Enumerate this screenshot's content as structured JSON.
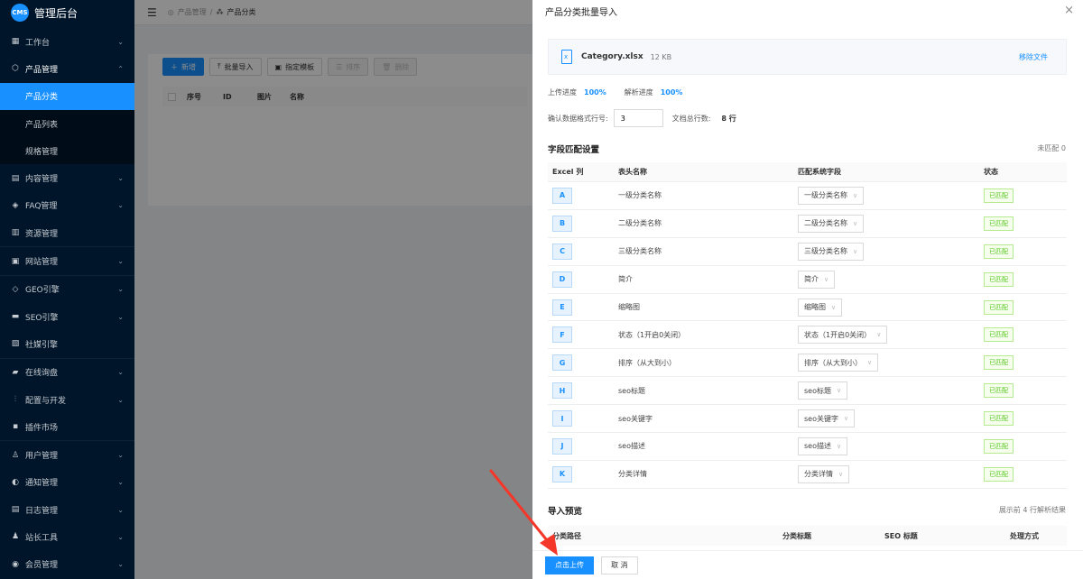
{
  "app": {
    "logo_badge": "CMS",
    "title": "管理后台"
  },
  "sidebar": {
    "items": [
      {
        "label": "工作台",
        "icon": "dashboard-icon",
        "chevron": "⌄"
      },
      {
        "label": "产品管理",
        "icon": "cube-icon",
        "chevron": "⌃"
      },
      {
        "label": "内容管理",
        "icon": "document-icon",
        "chevron": "⌄"
      },
      {
        "label": "FAQ管理",
        "icon": "tag-icon",
        "chevron": "⌄"
      },
      {
        "label": "资源管理",
        "icon": "folder-icon",
        "chevron": ""
      },
      {
        "label": "网站管理",
        "icon": "globe-icon",
        "chevron": "⌄"
      },
      {
        "label": "GEO引擎",
        "icon": "diamond-icon",
        "chevron": "⌄"
      },
      {
        "label": "SEO引擎",
        "icon": "monitor-icon",
        "chevron": "⌄"
      },
      {
        "label": "社媒引擎",
        "icon": "share-icon",
        "chevron": ""
      },
      {
        "label": "在线询盘",
        "icon": "chat-icon",
        "chevron": "⌄"
      },
      {
        "label": "配置与开发",
        "icon": "sliders-icon",
        "chevron": "⌄"
      },
      {
        "label": "插件市场",
        "icon": "plugin-icon",
        "chevron": ""
      },
      {
        "label": "用户管理",
        "icon": "user-icon",
        "chevron": "⌄"
      },
      {
        "label": "通知管理",
        "icon": "bell-icon",
        "chevron": "⌄"
      },
      {
        "label": "日志管理",
        "icon": "log-icon",
        "chevron": "⌄"
      },
      {
        "label": "站长工具",
        "icon": "tool-icon",
        "chevron": "⌄"
      },
      {
        "label": "会员管理",
        "icon": "member-icon",
        "chevron": "⌄"
      }
    ],
    "sub_items": [
      "产品分类",
      "产品列表",
      "规格管理"
    ]
  },
  "topbar": {
    "crumb1": "产品管理",
    "sep": "/",
    "crumb2": "产品分类"
  },
  "toolbar": {
    "add": "新增",
    "batch_import": "批量导入",
    "template": "指定模板",
    "sort": "排序",
    "delete": "删除"
  },
  "list_table": {
    "headers": [
      "序号",
      "ID",
      "图片",
      "名称"
    ]
  },
  "drawer": {
    "title": "产品分类批量导入",
    "close": "×",
    "file_name": "Category.xlsx",
    "file_size": "12 KB",
    "remove": "移除文件",
    "upload_progress_label": "上传进度",
    "upload_progress": "100%",
    "parse_progress_label": "解析进度",
    "parse_progress": "100%",
    "format_row_label": "确认数据格式行号:",
    "format_row_value": "3",
    "total_rows_label": "文档总行数:",
    "total_rows_value": "8 行",
    "mapping_title": "字段匹配设置",
    "unmatched": "未匹配 0",
    "mapping_headers": [
      "Excel 列",
      "表头名称",
      "匹配系统字段",
      "状态"
    ],
    "rows": [
      {
        "col": "A",
        "header": "一级分类名称",
        "field": "一级分类名称",
        "status": "已匹配"
      },
      {
        "col": "B",
        "header": "二级分类名称",
        "field": "二级分类名称",
        "status": "已匹配"
      },
      {
        "col": "C",
        "header": "三级分类名称",
        "field": "三级分类名称",
        "status": "已匹配"
      },
      {
        "col": "D",
        "header": "简介",
        "field": "简介",
        "status": "已匹配"
      },
      {
        "col": "E",
        "header": "缩略图",
        "field": "缩略图",
        "status": "已匹配"
      },
      {
        "col": "F",
        "header": "状态（1开启0关闭）",
        "field": "状态（1开启0关闭）",
        "status": "已匹配"
      },
      {
        "col": "G",
        "header": "排序（从大到小）",
        "field": "排序（从大到小）",
        "status": "已匹配"
      },
      {
        "col": "H",
        "header": "seo标题",
        "field": "seo标题",
        "status": "已匹配"
      },
      {
        "col": "I",
        "header": "seo关键字",
        "field": "seo关键字",
        "status": "已匹配"
      },
      {
        "col": "J",
        "header": "seo描述",
        "field": "seo描述",
        "status": "已匹配"
      },
      {
        "col": "K",
        "header": "分类详情",
        "field": "分类详情",
        "status": "已匹配"
      }
    ],
    "preview_title": "导入预览",
    "preview_note": "展示前 4 行解析结果",
    "preview_headers": [
      "分类路径",
      "分类标题",
      "SEO 标题",
      "处理方式"
    ],
    "submit": "点击上传",
    "cancel": "取 消"
  },
  "colors": {
    "primary": "#1890ff",
    "sidebar_bg": "#001529",
    "success": "#52c41a",
    "arrow": "#f5372a"
  }
}
